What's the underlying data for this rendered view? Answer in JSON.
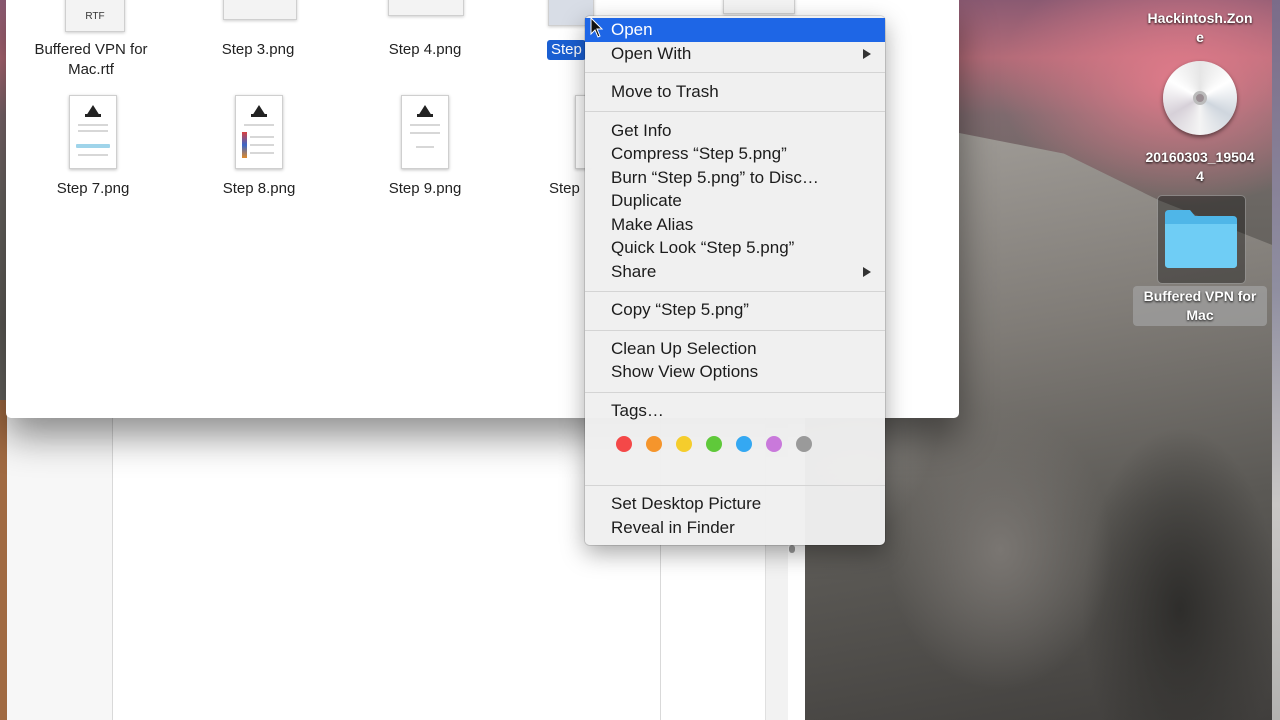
{
  "files": {
    "row1": [
      {
        "label_line1": "Buffered VPN for",
        "label_line2": "Mac.rtf",
        "thumb_text": "RTF"
      },
      {
        "label": "Step 3.png"
      },
      {
        "label": "Step 4.png"
      },
      {
        "label": "Step",
        "selected": true
      }
    ],
    "row2": [
      {
        "label": "Step 7.png"
      },
      {
        "label": "Step 8.png"
      },
      {
        "label": "Step 9.png"
      },
      {
        "label": "Step"
      }
    ]
  },
  "context_menu": {
    "open": "Open",
    "open_with": "Open With",
    "move_to_trash": "Move to Trash",
    "get_info": "Get Info",
    "compress": "Compress “Step 5.png”",
    "burn": "Burn “Step 5.png” to Disc…",
    "duplicate": "Duplicate",
    "make_alias": "Make Alias",
    "quick_look": "Quick Look “Step 5.png”",
    "share": "Share",
    "copy": "Copy “Step 5.png”",
    "clean_up": "Clean Up Selection",
    "view_options": "Show View Options",
    "tags": "Tags…",
    "tag_colors": [
      "#f44848",
      "#f5952c",
      "#f5cd2c",
      "#5fc93a",
      "#34a8f2",
      "#c979db",
      "#9a9a9a"
    ],
    "set_desktop": "Set Desktop Picture",
    "reveal": "Reveal in Finder"
  },
  "desktop": {
    "drive_label_line1": "Hackintosh.Zon",
    "drive_label_line2": "e",
    "disc_label_line1": "20160303_19504",
    "disc_label_line2": "4",
    "folder_label_line1": "Buffered VPN for",
    "folder_label_line2": "Mac"
  },
  "colors": {
    "selection_blue": "#1a5fd2",
    "menu_highlight": "#1e66e6",
    "folder_blue": "#5bc3f0"
  }
}
